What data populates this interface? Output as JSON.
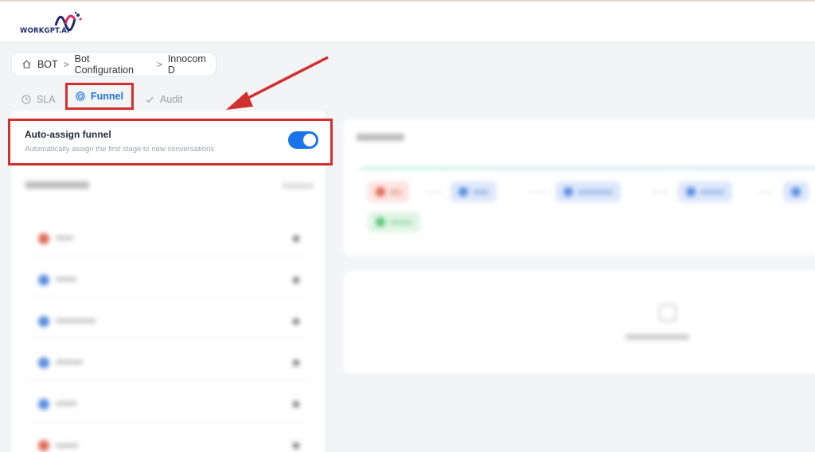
{
  "header": {
    "logo_text": "WORKGPT.AI"
  },
  "breadcrumb": {
    "items": [
      "BOT",
      "Bot Configuration",
      "Innocom D"
    ],
    "separator": ">"
  },
  "tabs": [
    {
      "label": "SLA",
      "icon": "clock-icon",
      "active": false
    },
    {
      "label": "Funnel",
      "icon": "target-icon",
      "active": true
    },
    {
      "label": "Audit",
      "icon": "check-icon",
      "active": false
    }
  ],
  "auto_assign": {
    "title": "Auto-assign funnel",
    "description": "Automatically assign the first stage to new conversations",
    "enabled": true
  },
  "colors": {
    "accent": "#1a73e8",
    "highlight": "#d32f2f",
    "stage_red": "#e06b5b",
    "stage_blue": "#5b8fe0",
    "stage_green": "#5cc878"
  }
}
